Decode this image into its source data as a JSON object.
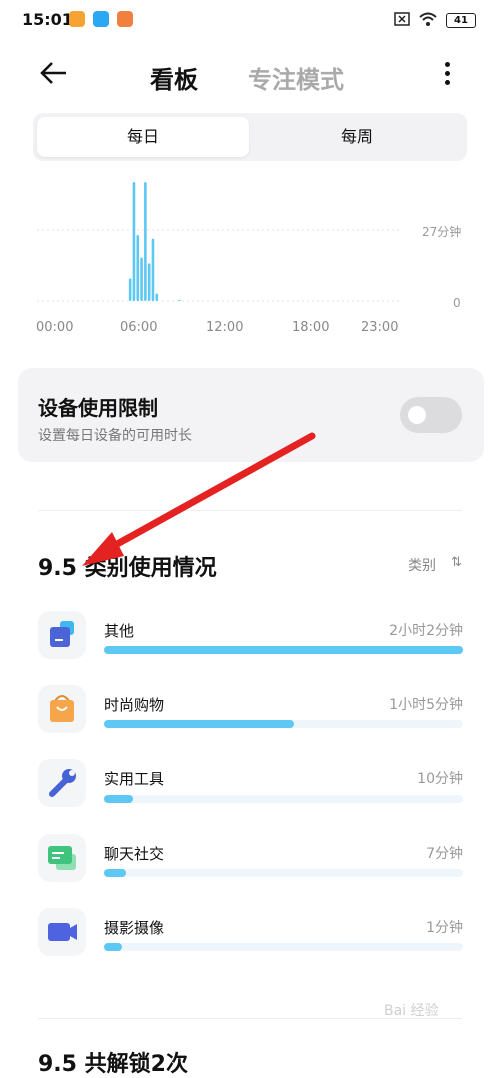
{
  "status_bar": {
    "time": "15:01",
    "battery": "41"
  },
  "header": {
    "tab_board": "看板",
    "tab_focus": "专注模式"
  },
  "segment": {
    "daily": "每日",
    "weekly": "每周"
  },
  "chart_data": {
    "type": "bar",
    "y_labels": [
      "27分钟",
      "0"
    ],
    "x_tick_labels": [
      "00:00",
      "06:00",
      "12:00",
      "18:00",
      "23:00"
    ],
    "values": [
      0,
      0,
      0,
      0,
      0,
      0,
      0,
      0,
      0,
      0,
      0,
      0,
      0,
      0,
      0,
      0,
      0,
      0,
      0,
      0,
      0,
      0,
      0,
      0,
      12,
      63,
      35,
      23,
      63,
      20,
      33,
      4,
      0,
      0,
      0,
      0,
      0,
      0.3,
      0,
      0,
      0,
      0,
      0,
      0,
      0,
      0,
      0,
      0,
      0,
      0,
      0,
      0,
      0,
      0,
      0,
      0,
      0,
      0,
      0,
      0,
      0,
      0,
      0,
      0,
      0,
      0,
      0,
      0,
      0,
      0,
      0,
      0,
      0,
      0,
      0,
      0,
      0,
      0,
      0,
      0,
      0,
      0,
      0,
      0,
      0,
      0,
      0,
      0,
      0,
      0,
      0,
      0,
      0,
      0,
      0,
      0
    ],
    "ylim": [
      0,
      63
    ],
    "color": "#5ec8f4",
    "grid": true
  },
  "device_limit": {
    "title": "设备使用限制",
    "subtitle": "设置每日设备的可用时长",
    "enabled": false
  },
  "category_section": {
    "date": "9.5",
    "title": "类别使用情况",
    "sort_label": "类别",
    "sort_icon": "⇅"
  },
  "categories": [
    {
      "name": "其他",
      "time": "2小时2分钟",
      "progress": 1.0,
      "icon": "other-icon",
      "color": "#4d63d8"
    },
    {
      "name": "时尚购物",
      "time": "1小时5分钟",
      "progress": 0.53,
      "icon": "shopping-bag-icon",
      "color": "#f5a64a"
    },
    {
      "name": "实用工具",
      "time": "10分钟",
      "progress": 0.08,
      "icon": "wrench-icon",
      "color": "#4662d6"
    },
    {
      "name": "聊天社交",
      "time": "7分钟",
      "progress": 0.06,
      "icon": "chat-icon",
      "color": "#3ec47d"
    },
    {
      "name": "摄影摄像",
      "time": "1分钟",
      "progress": 0.04,
      "icon": "camera-icon",
      "color": "#4f63e0"
    }
  ],
  "bottom_section": {
    "date": "9.5",
    "title": "共解锁2次"
  },
  "watermark": "Bai 经验"
}
